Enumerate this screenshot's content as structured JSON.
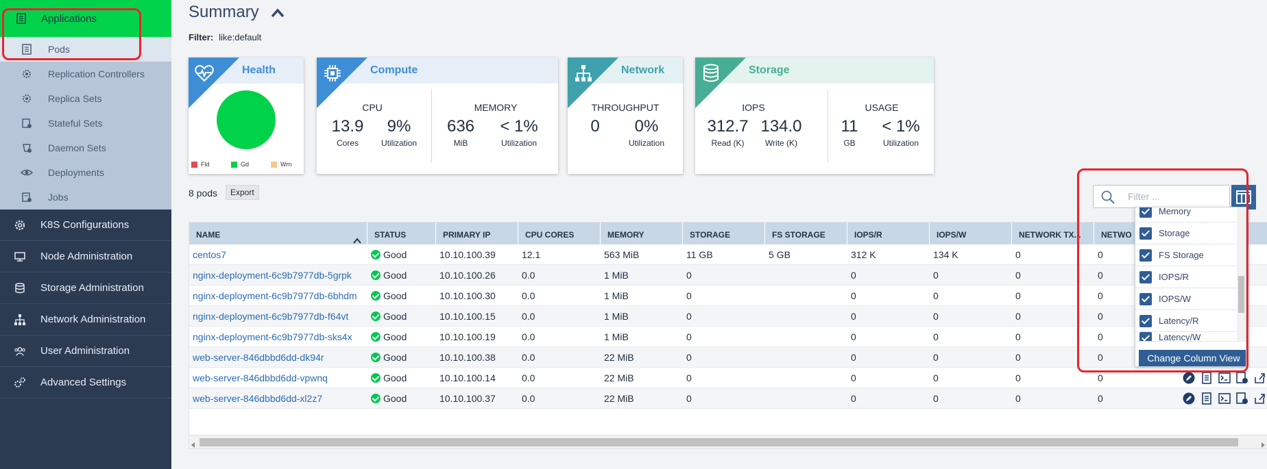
{
  "sidebar": {
    "active_item": {
      "label": "Applications",
      "icon": "list-icon"
    },
    "sub_items": [
      {
        "label": "Pods",
        "icon": "list-icon"
      },
      {
        "label": "Replication Controllers",
        "icon": "gear-icon"
      },
      {
        "label": "Replica Sets",
        "icon": "gear-icon"
      },
      {
        "label": "Stateful Sets",
        "icon": "gear-icon"
      },
      {
        "label": "Daemon Sets",
        "icon": "gear-icon"
      },
      {
        "label": "Deployments",
        "icon": "eye-icon"
      },
      {
        "label": "Jobs",
        "icon": "gear-icon"
      }
    ],
    "items": [
      {
        "label": "K8S Configurations",
        "icon": "gear-icon"
      },
      {
        "label": "Node Administration",
        "icon": "server-icon"
      },
      {
        "label": "Storage Administration",
        "icon": "database-icon"
      },
      {
        "label": "Network Administration",
        "icon": "network-icon"
      },
      {
        "label": "User Administration",
        "icon": "users-icon"
      },
      {
        "label": "Advanced Settings",
        "icon": "gears-icon"
      }
    ]
  },
  "summary": {
    "title": "Summary",
    "filter_label": "Filter:",
    "filter_value": "like:default"
  },
  "cards": {
    "health": {
      "title": "Health",
      "legend": [
        "Fld",
        "Gd",
        "Wrn"
      ],
      "colors": {
        "fld": "#e04a55",
        "gd": "#00d34a",
        "wrn": "#f5c98a"
      }
    },
    "compute": {
      "title": "Compute",
      "cpu_label": "CPU",
      "cpu_cores": "13.9",
      "cpu_cores_unit": "Cores",
      "cpu_util": "9%",
      "cpu_util_unit": "Utilization",
      "mem_label": "MEMORY",
      "mem_value": "636",
      "mem_unit": "MiB",
      "mem_util": "< 1%",
      "mem_util_unit": "Utilization"
    },
    "network": {
      "title": "Network",
      "tp_label": "THROUGHPUT",
      "tp_value": "0",
      "tp_util": "0%",
      "tp_util_unit": "Utilization"
    },
    "storage": {
      "title": "Storage",
      "iops_label": "IOPS",
      "iops_read": "312.7",
      "iops_read_unit": "Read (K)",
      "iops_write": "134.0",
      "iops_write_unit": "Write (K)",
      "usage_label": "USAGE",
      "usage_value": "11",
      "usage_unit": "GB",
      "usage_util": "< 1%",
      "usage_util_unit": "Utilization"
    }
  },
  "pods": {
    "count_label": "8 pods",
    "export_label": "Export",
    "search_placeholder": "Filter ..."
  },
  "table": {
    "columns": [
      "NAME",
      "STATUS",
      "PRIMARY IP",
      "CPU CORES",
      "MEMORY",
      "STORAGE",
      "FS STORAGE",
      "IOPS/R",
      "IOPS/W",
      "NETWORK TX...",
      "NETWO"
    ],
    "rows": [
      [
        "centos7",
        "Good",
        "10.10.100.39",
        "12.1",
        "563 MiB",
        "11 GB",
        "5 GB",
        "312 K",
        "134 K",
        "0",
        "0"
      ],
      [
        "nginx-deployment-6c9b7977db-5grpk",
        "Good",
        "10.10.100.26",
        "0.0",
        "1 MiB",
        "0",
        "",
        "0",
        "0",
        "0",
        "0"
      ],
      [
        "nginx-deployment-6c9b7977db-6bhdm",
        "Good",
        "10.10.100.30",
        "0.0",
        "1 MiB",
        "0",
        "",
        "0",
        "0",
        "0",
        "0"
      ],
      [
        "nginx-deployment-6c9b7977db-f64vt",
        "Good",
        "10.10.100.15",
        "0.0",
        "1 MiB",
        "0",
        "",
        "0",
        "0",
        "0",
        "0"
      ],
      [
        "nginx-deployment-6c9b7977db-sks4x",
        "Good",
        "10.10.100.19",
        "0.0",
        "1 MiB",
        "0",
        "",
        "0",
        "0",
        "0",
        "0"
      ],
      [
        "web-server-846dbbd6dd-dk94r",
        "Good",
        "10.10.100.38",
        "0.0",
        "22 MiB",
        "0",
        "",
        "0",
        "0",
        "0",
        "0"
      ],
      [
        "web-server-846dbbd6dd-vpwnq",
        "Good",
        "10.10.100.14",
        "0.0",
        "22 MiB",
        "0",
        "",
        "0",
        "0",
        "0",
        "0"
      ],
      [
        "web-server-846dbbd6dd-xl2z7",
        "Good",
        "10.10.100.37",
        "0.0",
        "22 MiB",
        "0",
        "",
        "0",
        "0",
        "0",
        "0"
      ]
    ]
  },
  "column_dropdown": {
    "options": [
      "Memory",
      "Storage",
      "FS Storage",
      "IOPS/R",
      "IOPS/W",
      "Latency/R",
      "Latency/W"
    ],
    "change_label": "Change Column View"
  }
}
